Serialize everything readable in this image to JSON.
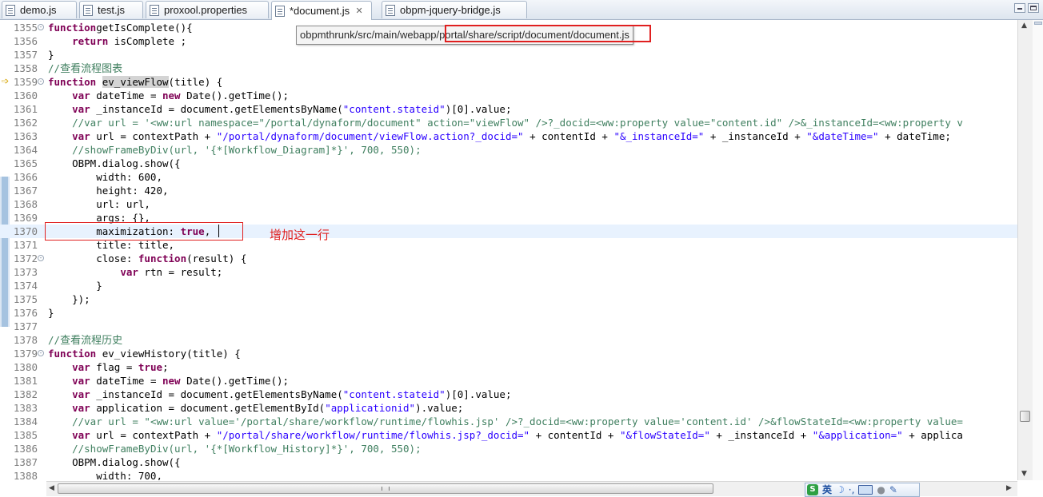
{
  "tabs": [
    {
      "label": "demo.js",
      "active": false
    },
    {
      "label": "test.js",
      "active": false
    },
    {
      "label": "proxool.properties",
      "active": false
    },
    {
      "label": "*document.js",
      "active": true,
      "close": "✕"
    },
    {
      "label": "obpm-jquery-bridge.js",
      "active": false
    }
  ],
  "tooltip": {
    "prefix": "obpmthrunk/src/main/webapp/",
    "highlight": "portal/share/script/document/document.js"
  },
  "annotation": "增加这一行",
  "lines": [
    {
      "n": "1355",
      "fold": "-",
      "parts": [
        [
          "kw",
          "function"
        ],
        [
          "",
          "getIsComplete(){"
        ]
      ]
    },
    {
      "n": "1356",
      "parts": [
        [
          "",
          "    "
        ],
        [
          "kw",
          "return"
        ],
        [
          "",
          " isComplete ;"
        ]
      ]
    },
    {
      "n": "1357",
      "parts": [
        [
          "",
          "}"
        ]
      ]
    },
    {
      "n": "1358",
      "parts": [
        [
          "cmt",
          "//"
        ],
        [
          "cmtcn",
          "查看流程图表"
        ]
      ]
    },
    {
      "n": "1359",
      "fold": "-",
      "arrow": true,
      "parts": [
        [
          "kw",
          "function"
        ],
        [
          "",
          " "
        ],
        [
          "occ",
          "ev_viewFlow"
        ],
        [
          "",
          "(title) {"
        ]
      ]
    },
    {
      "n": "1360",
      "parts": [
        [
          "",
          "    "
        ],
        [
          "kw",
          "var"
        ],
        [
          "",
          " dateTime = "
        ],
        [
          "kw",
          "new"
        ],
        [
          "",
          " Date().getTime();"
        ]
      ]
    },
    {
      "n": "1361",
      "parts": [
        [
          "",
          "    "
        ],
        [
          "kw",
          "var"
        ],
        [
          "",
          " _instanceId = document.getElementsByName("
        ],
        [
          "str",
          "\"content.stateid\""
        ],
        [
          "",
          ")[0].value;"
        ]
      ]
    },
    {
      "n": "1362",
      "parts": [
        [
          "",
          "    "
        ],
        [
          "cmt",
          "//var url = '<ww:url namespace=\"/portal/dynaform/document\" action=\"viewFlow\" />?_docid=<ww:property value=\"content.id\" />&_instanceId=<ww:property v"
        ]
      ]
    },
    {
      "n": "1363",
      "parts": [
        [
          "",
          "    "
        ],
        [
          "kw",
          "var"
        ],
        [
          "",
          " url = contextPath + "
        ],
        [
          "str",
          "\"/portal/dynaform/document/viewFlow.action?_docid=\""
        ],
        [
          "",
          " + contentId + "
        ],
        [
          "str",
          "\"&_instanceId=\""
        ],
        [
          "",
          " + _instanceId + "
        ],
        [
          "str",
          "\"&dateTime=\""
        ],
        [
          "",
          " + dateTime;"
        ]
      ]
    },
    {
      "n": "1364",
      "parts": [
        [
          "",
          "    "
        ],
        [
          "cmt",
          "//showFrameByDiv(url, '{*[Workflow_Diagram]*}', 700, 550);"
        ]
      ]
    },
    {
      "n": "1365",
      "parts": [
        [
          "",
          "    OBPM.dialog.show({"
        ]
      ]
    },
    {
      "n": "1366",
      "parts": [
        [
          "",
          "        width: 600,"
        ]
      ]
    },
    {
      "n": "1367",
      "parts": [
        [
          "",
          "        height: 420,"
        ]
      ]
    },
    {
      "n": "1368",
      "parts": [
        [
          "",
          "        url: url,"
        ]
      ]
    },
    {
      "n": "1369",
      "parts": [
        [
          "",
          "        args: {},"
        ]
      ]
    },
    {
      "n": "1370",
      "hl": true,
      "parts": [
        [
          "",
          "        maximization: "
        ],
        [
          "kw",
          "true"
        ],
        [
          "",
          ","
        ]
      ]
    },
    {
      "n": "1371",
      "parts": [
        [
          "",
          "        title: title,"
        ]
      ]
    },
    {
      "n": "1372",
      "fold": "-",
      "parts": [
        [
          "",
          "        close: "
        ],
        [
          "kw",
          "function"
        ],
        [
          "",
          "(result) {"
        ]
      ]
    },
    {
      "n": "1373",
      "parts": [
        [
          "",
          "            "
        ],
        [
          "kw",
          "var"
        ],
        [
          "",
          " rtn = result;"
        ]
      ]
    },
    {
      "n": "1374",
      "parts": [
        [
          "",
          "        }"
        ]
      ]
    },
    {
      "n": "1375",
      "parts": [
        [
          "",
          "    });"
        ]
      ]
    },
    {
      "n": "1376",
      "parts": [
        [
          "",
          "}"
        ]
      ]
    },
    {
      "n": "1377",
      "parts": [
        [
          "",
          ""
        ]
      ]
    },
    {
      "n": "1378",
      "parts": [
        [
          "cmt",
          "//"
        ],
        [
          "cmtcn",
          "查看流程历史"
        ]
      ]
    },
    {
      "n": "1379",
      "fold": "-",
      "parts": [
        [
          "kw",
          "function"
        ],
        [
          "",
          " ev_viewHistory(title) {"
        ]
      ]
    },
    {
      "n": "1380",
      "parts": [
        [
          "",
          "    "
        ],
        [
          "kw",
          "var"
        ],
        [
          "",
          " flag = "
        ],
        [
          "kw",
          "true"
        ],
        [
          "",
          ";"
        ]
      ]
    },
    {
      "n": "1381",
      "parts": [
        [
          "",
          "    "
        ],
        [
          "kw",
          "var"
        ],
        [
          "",
          " dateTime = "
        ],
        [
          "kw",
          "new"
        ],
        [
          "",
          " Date().getTime();"
        ]
      ]
    },
    {
      "n": "1382",
      "parts": [
        [
          "",
          "    "
        ],
        [
          "kw",
          "var"
        ],
        [
          "",
          " _instanceId = document.getElementsByName("
        ],
        [
          "str",
          "\"content.stateid\""
        ],
        [
          "",
          ")[0].value;"
        ]
      ]
    },
    {
      "n": "1383",
      "parts": [
        [
          "",
          "    "
        ],
        [
          "kw",
          "var"
        ],
        [
          "",
          " application = document.getElementById("
        ],
        [
          "str",
          "\"applicationid\""
        ],
        [
          "",
          ").value;"
        ]
      ]
    },
    {
      "n": "1384",
      "parts": [
        [
          "",
          "    "
        ],
        [
          "cmt",
          "//var url = \"<ww:url value='/portal/share/workflow/runtime/flowhis.jsp' />?_docid=<ww:property value='content.id' />&flowStateId=<ww:property value="
        ]
      ]
    },
    {
      "n": "1385",
      "parts": [
        [
          "",
          "    "
        ],
        [
          "kw",
          "var"
        ],
        [
          "",
          " url = contextPath + "
        ],
        [
          "str",
          "\"/portal/share/workflow/runtime/flowhis.jsp?_docid=\""
        ],
        [
          "",
          " + contentId + "
        ],
        [
          "str",
          "\"&flowStateId=\""
        ],
        [
          "",
          " + _instanceId + "
        ],
        [
          "str",
          "\"&application=\""
        ],
        [
          "",
          " + applica"
        ]
      ]
    },
    {
      "n": "1386",
      "parts": [
        [
          "",
          "    "
        ],
        [
          "cmt",
          "//showFrameByDiv(url, '{*[Workflow_History]*}', 700, 550);"
        ]
      ]
    },
    {
      "n": "1387",
      "parts": [
        [
          "",
          "    OBPM.dialog.show({"
        ]
      ]
    },
    {
      "n": "1388",
      "parts": [
        [
          "",
          "        width: 700,"
        ]
      ]
    }
  ],
  "ime": {
    "logo": "S",
    "lang": "英",
    "moon": "☽",
    "punc": "·,"
  }
}
